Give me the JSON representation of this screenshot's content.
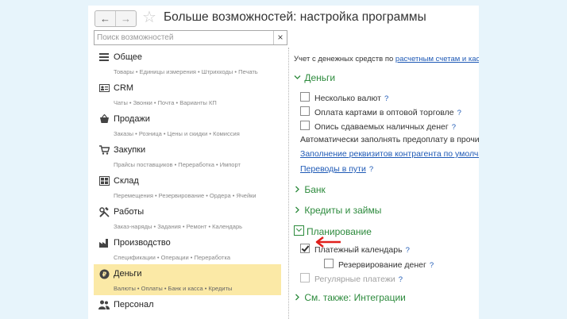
{
  "window": {
    "title": "Больше возможностей: настройка программы",
    "back_icon": "←",
    "forward_icon": "→",
    "favorite_icon": "☆"
  },
  "search": {
    "placeholder": "Поиск возможностей",
    "value": "",
    "clear_icon": "×"
  },
  "categories": [
    {
      "name": "Общее",
      "sub": "Товары • Единицы измерения • Штрихкоды • Печать",
      "icon": "list-icon"
    },
    {
      "name": "CRM",
      "sub": "Чаты • Звонки • Почта • Варианты КП",
      "icon": "contact-card-icon"
    },
    {
      "name": "Продажи",
      "sub": "Заказы • Розница • Цены и скидки • Комиссия",
      "icon": "basket-icon"
    },
    {
      "name": "Закупки",
      "sub": "Прайсы поставщиков • Переработка • Импорт",
      "icon": "cart-icon"
    },
    {
      "name": "Склад",
      "sub": "Перемещения • Резервирование • Ордера • Ячейки",
      "icon": "warehouse-icon"
    },
    {
      "name": "Работы",
      "sub": "Заказ-наряды • Задания • Ремонт • Календарь",
      "icon": "tools-icon"
    },
    {
      "name": "Производство",
      "sub": "Спецификации • Операции • Переработка",
      "icon": "factory-icon"
    },
    {
      "name": "Деньги",
      "sub": "Валюты • Оплаты • Банк и касса • Кредиты",
      "icon": "ruble-coin-icon",
      "active": true
    },
    {
      "name": "Персонал",
      "sub": "",
      "icon": "people-icon"
    }
  ],
  "right": {
    "intro_text": "Учет с денежных средств по ",
    "intro_link": "расчетным счетам и кассам",
    "money_section": "Деньги",
    "opt_multi_currency": "Несколько валют",
    "opt_card_payments": "Оплата картами в оптовой торговле",
    "opt_cash_inventory": "Опись сдаваемых наличных денег",
    "auto_fill_text": "Автоматически заполнять предоплату в прочих документах",
    "link_counterparty_defaults": "Заполнение реквизитов контрагента по умолчанию",
    "link_transfers": "Переводы в пути",
    "bank_section": "Банк",
    "credits_section": "Кредиты и займы",
    "planning_section": "Планирование",
    "opt_payment_calendar": "Платежный календарь",
    "opt_money_reservation": "Резервирование денег",
    "opt_regular_payments": "Регулярные платежи",
    "see_also_section": "См. также: Интеграции",
    "help_mark": "?"
  },
  "colors": {
    "accent_green": "#2c8a3c",
    "link_blue": "#1f5ab6",
    "active_bg": "#fbe9a6",
    "arrow_red": "#e0201c"
  }
}
